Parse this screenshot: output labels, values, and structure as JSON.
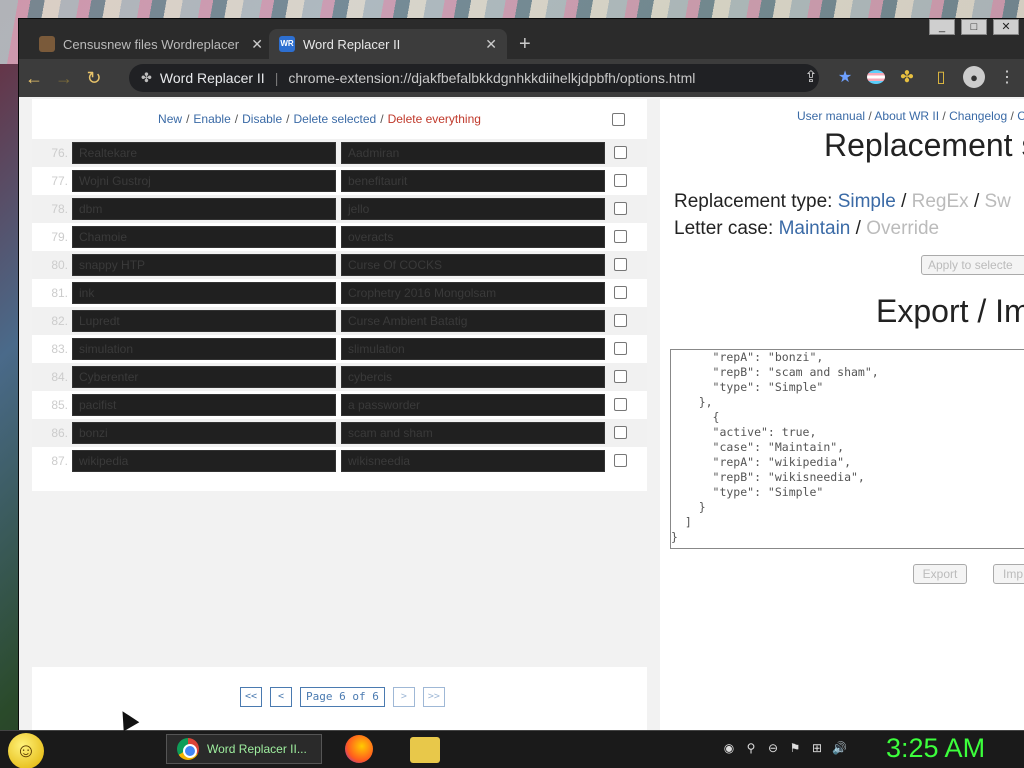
{
  "tabs": [
    {
      "title": "Censusnew files Wordreplacer"
    },
    {
      "title": "Word Replacer II"
    }
  ],
  "toolbar": {
    "ext_name": "Word Replacer II",
    "url": "chrome-extension://djakfbefalbkkdgnhkkdiihelkjdpbfh/options.html"
  },
  "list_actions": {
    "new": "New",
    "enable": "Enable",
    "disable": "Disable",
    "delete_selected": "Delete selected",
    "delete_everything": "Delete everything",
    "sep": "/"
  },
  "rows": [
    {
      "num": "76.",
      "a": "Realtekare",
      "b": "Aadmiran"
    },
    {
      "num": "77.",
      "a": "Wojni Gustroj",
      "b": "benefitaurit"
    },
    {
      "num": "78.",
      "a": "dbm",
      "b": "jello"
    },
    {
      "num": "79.",
      "a": "Chamoie",
      "b": "overacts"
    },
    {
      "num": "80.",
      "a": "snappy HTP",
      "b": "Curse Of COCKS"
    },
    {
      "num": "81.",
      "a": "ink",
      "b": "Crophetry 2016 Mongolsam"
    },
    {
      "num": "82.",
      "a": "Lupredt",
      "b": "Curse Ambient Batatig"
    },
    {
      "num": "83.",
      "a": "simulation",
      "b": "slimulation"
    },
    {
      "num": "84.",
      "a": "Cyberenter",
      "b": "cybercis"
    },
    {
      "num": "85.",
      "a": "pacifist",
      "b": "a passworder"
    },
    {
      "num": "86.",
      "a": "bonzi",
      "b": "scam and sham"
    },
    {
      "num": "87.",
      "a": "wikipedia",
      "b": "wikisneedia"
    }
  ],
  "pager": {
    "first": "<<",
    "prev": "<",
    "label": "Page 6 of 6",
    "next": ">",
    "last": ">>"
  },
  "right": {
    "links": {
      "manual": "User manual",
      "about": "About WR II",
      "changelog": "Changelog",
      "more": "C",
      "sep": "/"
    },
    "title": "Replacement s",
    "type_label": "Replacement type:",
    "type_simple": "Simple",
    "type_regex": "RegEx",
    "type_sw": "Sw",
    "case_label": "Letter case:",
    "case_maintain": "Maintain",
    "case_override": "Override",
    "sep": "/",
    "apply_btn": "Apply to selecte",
    "export_title": "Export / Im",
    "json_text": "      \"repA\": \"bonzi\",\n      \"repB\": \"scam and sham\",\n      \"type\": \"Simple\"\n    },\n      {\n      \"active\": true,\n      \"case\": \"Maintain\",\n      \"repA\": \"wikipedia\",\n      \"repB\": \"wikisneedia\",\n      \"type\": \"Simple\"\n    }\n  ]\n}",
    "export_btn": "Export",
    "import_btn": "Imp"
  },
  "taskbar": {
    "task_label": "Word Replacer II...",
    "clock": "3:25 AM"
  },
  "colors": {
    "link": "#3a6aa6",
    "danger": "#c0392b",
    "clock": "#3cff3c"
  }
}
